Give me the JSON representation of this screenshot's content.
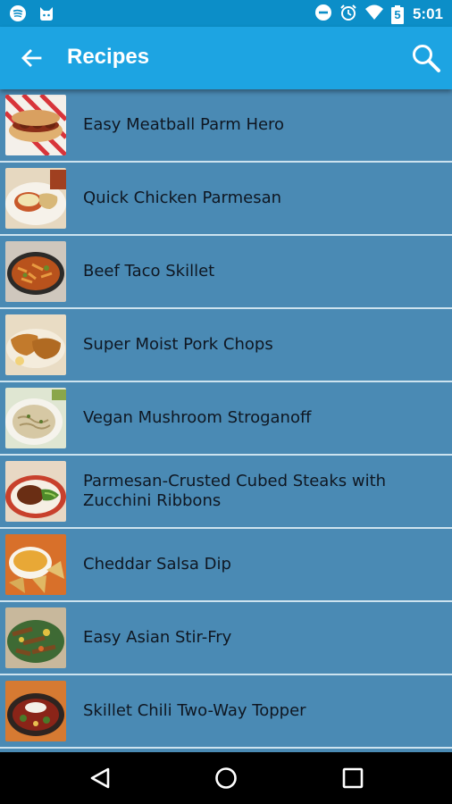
{
  "status_bar": {
    "time": "5:01",
    "left_icons": [
      "spotify-icon",
      "notification-cat-icon"
    ],
    "right_icons": [
      "do-not-disturb-icon",
      "alarm-icon",
      "wifi-icon",
      "battery-icon"
    ],
    "battery_level": "5"
  },
  "app_bar": {
    "title": "Recipes",
    "back_icon": "arrow-back-icon",
    "search_icon": "search-icon"
  },
  "recipes": [
    {
      "name": "Easy Meatball Parm Hero"
    },
    {
      "name": "Quick Chicken Parmesan"
    },
    {
      "name": "Beef Taco Skillet"
    },
    {
      "name": "Super Moist Pork Chops"
    },
    {
      "name": "Vegan Mushroom Stroganoff"
    },
    {
      "name": "Parmesan-Crusted Cubed Steaks with Zucchini Ribbons"
    },
    {
      "name": "Cheddar Salsa Dip"
    },
    {
      "name": "Easy Asian Stir-Fry"
    },
    {
      "name": "Skillet Chili Two-Way Topper"
    }
  ],
  "nav_bar": {
    "icons": [
      "nav-back-icon",
      "nav-home-icon",
      "nav-recents-icon"
    ]
  },
  "colors": {
    "status_bar": "#0c8ec8",
    "app_bar": "#1da4e2",
    "list_bg": "#4a8ab4",
    "divider": "#cde3ef",
    "text": "#0f1722"
  }
}
